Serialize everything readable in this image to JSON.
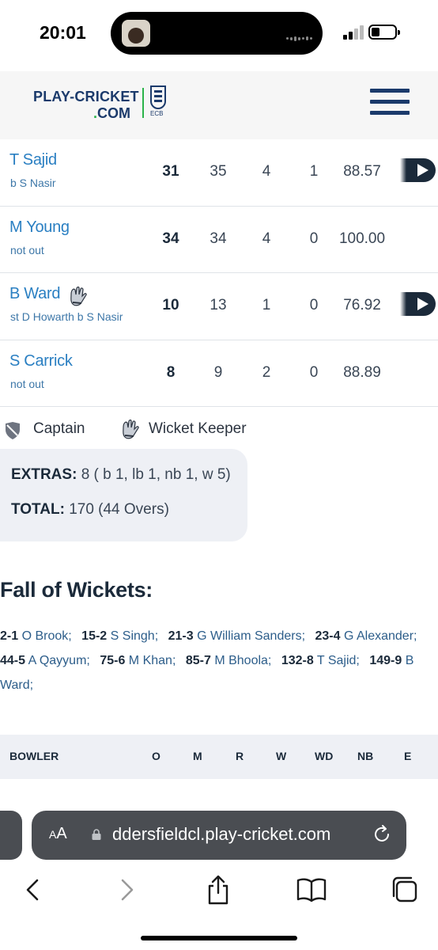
{
  "status_bar": {
    "time": "20:01"
  },
  "header": {
    "logo_line1": "PLAY-CRICKET",
    "logo_line2_dot": ".",
    "logo_line2": "COM",
    "ecb_text": "ECB"
  },
  "batting": [
    {
      "name": "T Sajid",
      "dismissal": "b S Nasir",
      "runs": "31",
      "balls": "35",
      "fours": "4",
      "sixes": "1",
      "sr": "88.57",
      "keeper": false,
      "video": true
    },
    {
      "name": "M Young",
      "dismissal": "not out",
      "runs": "34",
      "balls": "34",
      "fours": "4",
      "sixes": "0",
      "sr": "100.00",
      "keeper": false,
      "video": false
    },
    {
      "name": "B Ward",
      "dismissal": "st D Howarth b S Nasir",
      "runs": "10",
      "balls": "13",
      "fours": "1",
      "sixes": "0",
      "sr": "76.92",
      "keeper": true,
      "video": true
    },
    {
      "name": "S Carrick",
      "dismissal": "not out",
      "runs": "8",
      "balls": "9",
      "fours": "2",
      "sixes": "0",
      "sr": "88.89",
      "keeper": false,
      "video": false
    }
  ],
  "legend": {
    "captain": "Captain",
    "wicket_keeper": "Wicket Keeper"
  },
  "extras": {
    "extras_label": "EXTRAS:",
    "extras_value": "8 ( b 1, lb 1, nb 1, w 5)",
    "total_label": "TOTAL:",
    "total_value": "170 (44 Overs)"
  },
  "fall_of_wickets": {
    "title": "Fall of Wickets:",
    "entries": [
      {
        "score": "2-1",
        "player": "O Brook"
      },
      {
        "score": "15-2",
        "player": "S Singh"
      },
      {
        "score": "21-3",
        "player": "G William Sanders"
      },
      {
        "score": "23-4",
        "player": "G Alexander"
      },
      {
        "score": "44-5",
        "player": "A Qayyum"
      },
      {
        "score": "75-6",
        "player": "M Khan"
      },
      {
        "score": "85-7",
        "player": "M Bhoola"
      },
      {
        "score": "132-8",
        "player": "T Sajid"
      },
      {
        "score": "149-9",
        "player": "B Ward"
      }
    ]
  },
  "bowling_header": {
    "bowler": "BOWLER",
    "o": "O",
    "m": "M",
    "r": "R",
    "w": "W",
    "wd": "WD",
    "nb": "NB",
    "e": "E"
  },
  "browser": {
    "aa_small": "A",
    "aa_large": "A",
    "url": "ddersfieldcl.play-cricket.com"
  },
  "colors": {
    "brand_navy": "#1b3a6b",
    "brand_green": "#2bb34a",
    "link_blue": "#2a7fc2",
    "panel_grey": "#eef0f5"
  }
}
